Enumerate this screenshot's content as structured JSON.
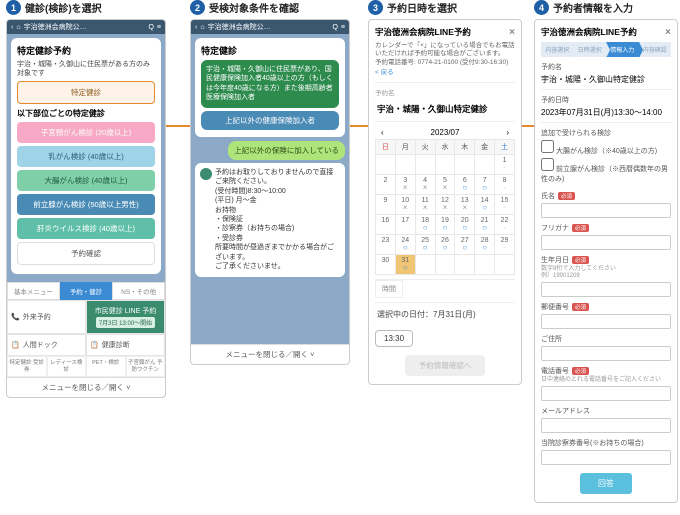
{
  "steps": {
    "s1": {
      "num": "1",
      "title": "健診(検診)を選択"
    },
    "s2": {
      "num": "2",
      "title": "受検対象条件を確認"
    },
    "s3": {
      "num": "3",
      "title": "予約日時を選択"
    },
    "s4": {
      "num": "4",
      "title": "予約者情報を入力"
    }
  },
  "col1": {
    "header": "宇治徳洲会病院公…",
    "card_title": "特定健診予約",
    "card_note": "宇治・城陽・久御山に住民票がある方のみ対象です",
    "btn_tokutei": "特定健診",
    "section": "以下部位ごとの特定健診",
    "btns": {
      "cervical": "子宮頸がん検診 (20歳以上)",
      "breast": "乳がん検診 (40歳以上)",
      "colon": "大腸がん検診 (40歳以上)",
      "prostate": "前立腺がん検診 (50歳以上男性)",
      "liver": "肝炎ウイルス検診 (40歳以上)",
      "confirm": "予約確認"
    },
    "tabs": {
      "t1": "基本メニュー",
      "t2": "予約・健診",
      "t3": "NS・その他"
    },
    "quick": {
      "outpatient": "外来予約",
      "line_resv": "市民健診 LINE 予約",
      "line_sub": "7月3日 13:00～開始",
      "dock": "人間ドック",
      "health": "健康診断"
    },
    "mini": {
      "m1": "特定健診\n受診券",
      "m2": "レディース検診",
      "m3": "PET・検診",
      "m4": "子宮頸がん\n予防ワクチン"
    },
    "footer": "メニューを閉じる／開く ˅"
  },
  "col2": {
    "header": "宇治徳洲会病院公…",
    "card_title": "特定健診",
    "green": "宇治・城陽・久御山に住民票があり、国民健康保険加入者40歳以上の方（もしくは今年度40歳になる方）また後期高齢者医療保険加入者",
    "blue": "上記以外の健康保険加入者",
    "user": "上記以外の保険に加入している",
    "white": "予約はお取りしておりませんので直接ご来院ください。\n(受付時間)8:30～10:00\n(平日) 月～金\nお持物\n・保険証\n・診察券（お持ちの場合)\n・受診券\n所要時間が昼過ぎまでかかる場合がございます。\nご了承くださいませ。",
    "footer": "メニューを閉じる／開く ˅"
  },
  "col3": {
    "title": "宇治徳洲会病院LINE予約",
    "notes": {
      "l1": "カレンダーで「×」になっている場合でもお電話いただければ予約可能な場合がございます。",
      "l2": "予約電話番号: 0774-21-0100 (受付9:30-16:30)",
      "back": "< 戻る"
    },
    "resv_label": "予約名",
    "resv_name": "宇治・城陽・久御山特定健診",
    "month": "2023/07",
    "dow": [
      "日",
      "月",
      "火",
      "水",
      "木",
      "金",
      "土"
    ],
    "weeks": [
      [
        [
          "",
          ""
        ],
        [
          "",
          ""
        ],
        [
          "",
          ""
        ],
        [
          "",
          ""
        ],
        [
          "",
          ""
        ],
        [
          "",
          ""
        ],
        [
          "1",
          "-"
        ]
      ],
      [
        [
          "2",
          ""
        ],
        [
          "3",
          "×"
        ],
        [
          "4",
          "×"
        ],
        [
          "5",
          "×"
        ],
        [
          "6",
          "○"
        ],
        [
          "7",
          "○"
        ],
        [
          "8",
          "-"
        ]
      ],
      [
        [
          "9",
          ""
        ],
        [
          "10",
          "×"
        ],
        [
          "11",
          "×"
        ],
        [
          "12",
          "×"
        ],
        [
          "13",
          "×"
        ],
        [
          "14",
          "○"
        ],
        [
          "15",
          "-"
        ]
      ],
      [
        [
          "16",
          ""
        ],
        [
          "17",
          ""
        ],
        [
          "18",
          "○"
        ],
        [
          "19",
          "○"
        ],
        [
          "20",
          "○"
        ],
        [
          "21",
          "○"
        ],
        [
          "22",
          "-"
        ]
      ],
      [
        [
          "23",
          ""
        ],
        [
          "24",
          "○"
        ],
        [
          "25",
          "○"
        ],
        [
          "26",
          "○"
        ],
        [
          "27",
          "○"
        ],
        [
          "28",
          "○"
        ],
        [
          "29",
          "-"
        ]
      ],
      [
        [
          "30",
          ""
        ],
        [
          "31",
          "○"
        ],
        [
          "",
          ""
        ],
        [
          "",
          ""
        ],
        [
          "",
          ""
        ],
        [
          "",
          ""
        ],
        [
          "",
          ""
        ]
      ]
    ],
    "time_head": "時間",
    "sel_label": "選択中の日付：7月31日(月)",
    "time_chip": "13:30",
    "ghost": "予約情報確認へ"
  },
  "col4": {
    "title": "宇治徳洲会病院LINE予約",
    "psteps": [
      "内容選択",
      "日時選択",
      "情報入力",
      "内容確認"
    ],
    "active_step": 2,
    "f": {
      "resv_label": "予約名",
      "resv_name": "宇治・城陽・久御山特定健診",
      "dt_label": "予約日時",
      "dt_value": "2023年07月31日(月)13:30～14:00",
      "opts_label": "追加で受けられる検診",
      "opt1": "大腸がん検診（※40歳以上の方)",
      "opt2": "前立腺がん検診（※西暦偶数年の男性のみ)",
      "name_label": "氏名",
      "kana_label": "フリガナ",
      "dob_label": "生年月日",
      "dob_hint": "数字8桁で入力してください\n例）19901209",
      "zip_label": "郵便番号",
      "addr_label": "ご住所",
      "tel_label": "電話番号",
      "tel_hint": "日中連絡のとれる電話番号をご記入ください",
      "mail_label": "メールアドレス",
      "card_label": "当院診察券番号(※お持ちの場合)",
      "req": "必須",
      "submit": "回答"
    }
  }
}
